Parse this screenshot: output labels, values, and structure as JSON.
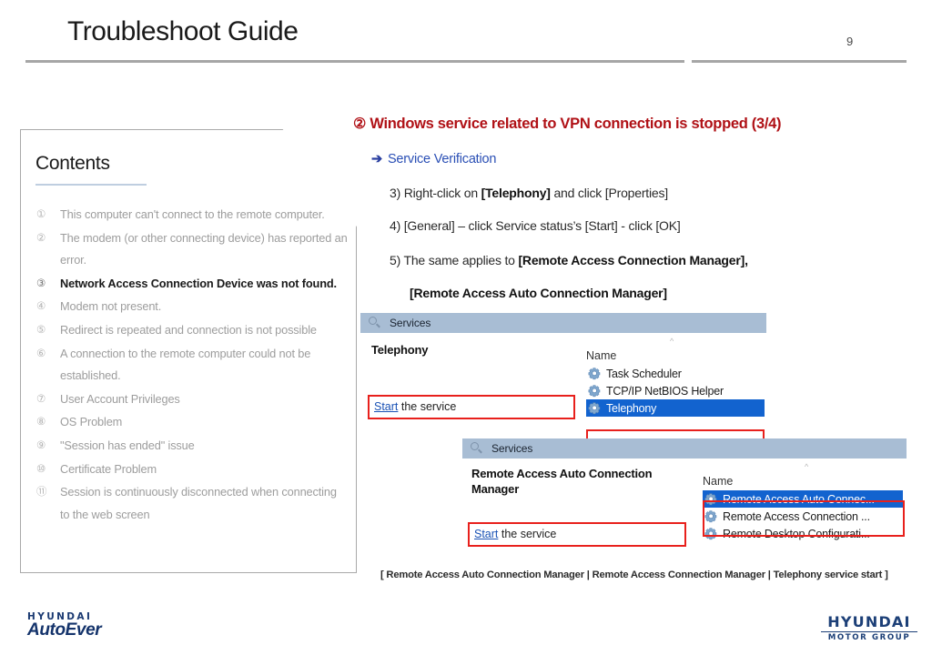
{
  "header": {
    "title": "Troubleshoot Guide",
    "page_number": "9"
  },
  "contents": {
    "heading": "Contents",
    "items": [
      {
        "num": "①",
        "text": "This computer can't connect to the remote computer.",
        "active": false
      },
      {
        "num": "②",
        "text": "The modem (or other connecting device) has reported an error.",
        "active": false
      },
      {
        "num": "③",
        "text": "Network Access Connection Device was not found.",
        "active": true
      },
      {
        "num": "④",
        "text": "Modem not present.",
        "active": false
      },
      {
        "num": "⑤",
        "text": "Redirect is repeated and connection is not possible",
        "active": false
      },
      {
        "num": "⑥",
        "text": "A connection to the remote computer could not be established.",
        "active": false
      },
      {
        "num": "⑦",
        "text": "User Account Privileges",
        "active": false
      },
      {
        "num": "⑧",
        "text": "OS Problem",
        "active": false
      },
      {
        "num": "⑨",
        "text": "\"Session has ended\" issue",
        "active": false
      },
      {
        "num": "⑩",
        "text": "Certificate Problem",
        "active": false
      },
      {
        "num": "⑪",
        "text": "Session is continuously disconnected when connecting to the web screen",
        "active": false
      }
    ]
  },
  "main": {
    "heading_num": "②",
    "heading_text": "Windows service related to VPN connection is stopped (3/4)",
    "sub_heading_arrow": "➔",
    "sub_heading": "Service Verification",
    "step3_pre": "3) Right-click on ",
    "step3_bold": "[Telephony]",
    "step3_post": " and click [Properties]",
    "step4": "4) [General] – click Service status’s [Start]  - click [OK]",
    "step5_pre": "5) The same applies to ",
    "step5_bold": "[Remote Access Connection Manager],",
    "step5_second_line": "[Remote Access Auto Connection Manager]",
    "caption": "[ Remote Access Auto Connection Manager | Remote Access Connection Manager | Telephony service start ]"
  },
  "services_window_1": {
    "title": "Services",
    "service_name": "Telephony",
    "start_link": "Start",
    "start_rest": " the service",
    "column_header": "Name",
    "rows": [
      {
        "label": "Task Scheduler",
        "selected": false
      },
      {
        "label": "TCP/IP NetBIOS Helper",
        "selected": false
      },
      {
        "label": "Telephony",
        "selected": true
      }
    ]
  },
  "services_window_2": {
    "title": "Services",
    "service_name_line1": "Remote Access Auto Connection",
    "service_name_line2": "Manager",
    "start_link": "Start",
    "start_rest": " the service",
    "column_header": "Name",
    "rows": [
      {
        "label": "Remote Access Auto Connec...",
        "selected": true
      },
      {
        "label": "Remote Access Connection ...",
        "selected": false
      },
      {
        "label": "Remote Desktop Configurati...",
        "selected": false
      }
    ]
  },
  "footer": {
    "left_logo_top": "HYUNDAI",
    "left_logo_bottom": "AutoEver",
    "right_logo_top": "HYUNDAI",
    "right_logo_bottom": "MOTOR GROUP"
  },
  "colors": {
    "accent_red": "#b01116",
    "highlight_blue": "#1263cf",
    "box_red": "#e8201c",
    "link_blue": "#1a52b5",
    "brand_navy": "#1c3f77"
  }
}
